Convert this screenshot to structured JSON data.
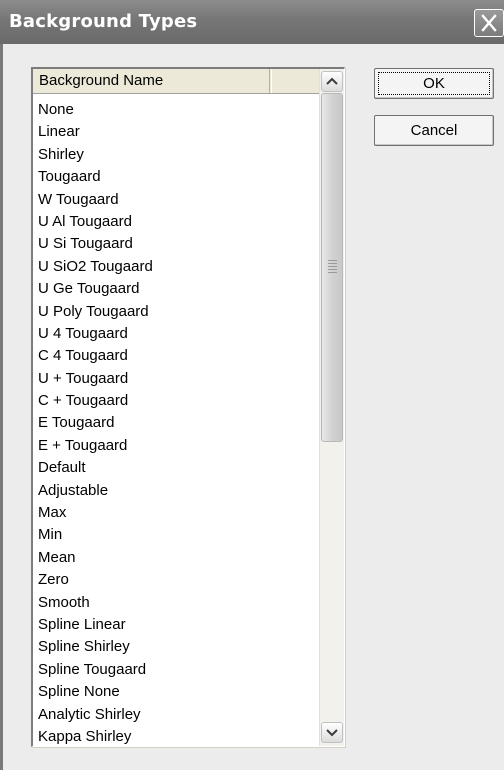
{
  "window": {
    "title": "Background Types",
    "close_icon": "close-x-icon"
  },
  "list": {
    "column_header": "Background Name",
    "items": [
      "None",
      "Linear",
      "Shirley",
      "Tougaard",
      "W Tougaard",
      "U Al Tougaard",
      "U Si Tougaard",
      "U SiO2 Tougaard",
      "U Ge Tougaard",
      "U Poly Tougaard",
      "U 4 Tougaard",
      "C 4 Tougaard",
      "U + Tougaard",
      "C + Tougaard",
      "E Tougaard",
      "E + Tougaard",
      "Default",
      "Adjustable",
      "Max",
      "Min",
      "Mean",
      "Zero",
      "Smooth",
      "Spline Linear",
      "Spline Shirley",
      "Spline Tougaard",
      "Spline None",
      "Analytic Shirley",
      "Kappa Shirley"
    ]
  },
  "buttons": {
    "ok": "OK",
    "cancel": "Cancel"
  },
  "colors": {
    "titlebar": "#767676",
    "dialog_bg": "#ececec"
  }
}
